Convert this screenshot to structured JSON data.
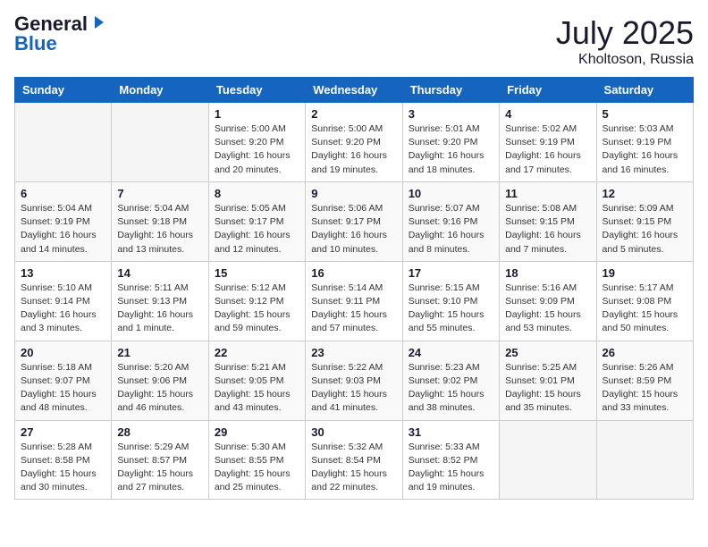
{
  "header": {
    "logo_general": "General",
    "logo_blue": "Blue",
    "month": "July 2025",
    "location": "Kholtoson, Russia"
  },
  "weekdays": [
    "Sunday",
    "Monday",
    "Tuesday",
    "Wednesday",
    "Thursday",
    "Friday",
    "Saturday"
  ],
  "weeks": [
    [
      {
        "day": "",
        "info": ""
      },
      {
        "day": "",
        "info": ""
      },
      {
        "day": "1",
        "info": "Sunrise: 5:00 AM\nSunset: 9:20 PM\nDaylight: 16 hours\nand 20 minutes."
      },
      {
        "day": "2",
        "info": "Sunrise: 5:00 AM\nSunset: 9:20 PM\nDaylight: 16 hours\nand 19 minutes."
      },
      {
        "day": "3",
        "info": "Sunrise: 5:01 AM\nSunset: 9:20 PM\nDaylight: 16 hours\nand 18 minutes."
      },
      {
        "day": "4",
        "info": "Sunrise: 5:02 AM\nSunset: 9:19 PM\nDaylight: 16 hours\nand 17 minutes."
      },
      {
        "day": "5",
        "info": "Sunrise: 5:03 AM\nSunset: 9:19 PM\nDaylight: 16 hours\nand 16 minutes."
      }
    ],
    [
      {
        "day": "6",
        "info": "Sunrise: 5:04 AM\nSunset: 9:19 PM\nDaylight: 16 hours\nand 14 minutes."
      },
      {
        "day": "7",
        "info": "Sunrise: 5:04 AM\nSunset: 9:18 PM\nDaylight: 16 hours\nand 13 minutes."
      },
      {
        "day": "8",
        "info": "Sunrise: 5:05 AM\nSunset: 9:17 PM\nDaylight: 16 hours\nand 12 minutes."
      },
      {
        "day": "9",
        "info": "Sunrise: 5:06 AM\nSunset: 9:17 PM\nDaylight: 16 hours\nand 10 minutes."
      },
      {
        "day": "10",
        "info": "Sunrise: 5:07 AM\nSunset: 9:16 PM\nDaylight: 16 hours\nand 8 minutes."
      },
      {
        "day": "11",
        "info": "Sunrise: 5:08 AM\nSunset: 9:15 PM\nDaylight: 16 hours\nand 7 minutes."
      },
      {
        "day": "12",
        "info": "Sunrise: 5:09 AM\nSunset: 9:15 PM\nDaylight: 16 hours\nand 5 minutes."
      }
    ],
    [
      {
        "day": "13",
        "info": "Sunrise: 5:10 AM\nSunset: 9:14 PM\nDaylight: 16 hours\nand 3 minutes."
      },
      {
        "day": "14",
        "info": "Sunrise: 5:11 AM\nSunset: 9:13 PM\nDaylight: 16 hours\nand 1 minute."
      },
      {
        "day": "15",
        "info": "Sunrise: 5:12 AM\nSunset: 9:12 PM\nDaylight: 15 hours\nand 59 minutes."
      },
      {
        "day": "16",
        "info": "Sunrise: 5:14 AM\nSunset: 9:11 PM\nDaylight: 15 hours\nand 57 minutes."
      },
      {
        "day": "17",
        "info": "Sunrise: 5:15 AM\nSunset: 9:10 PM\nDaylight: 15 hours\nand 55 minutes."
      },
      {
        "day": "18",
        "info": "Sunrise: 5:16 AM\nSunset: 9:09 PM\nDaylight: 15 hours\nand 53 minutes."
      },
      {
        "day": "19",
        "info": "Sunrise: 5:17 AM\nSunset: 9:08 PM\nDaylight: 15 hours\nand 50 minutes."
      }
    ],
    [
      {
        "day": "20",
        "info": "Sunrise: 5:18 AM\nSunset: 9:07 PM\nDaylight: 15 hours\nand 48 minutes."
      },
      {
        "day": "21",
        "info": "Sunrise: 5:20 AM\nSunset: 9:06 PM\nDaylight: 15 hours\nand 46 minutes."
      },
      {
        "day": "22",
        "info": "Sunrise: 5:21 AM\nSunset: 9:05 PM\nDaylight: 15 hours\nand 43 minutes."
      },
      {
        "day": "23",
        "info": "Sunrise: 5:22 AM\nSunset: 9:03 PM\nDaylight: 15 hours\nand 41 minutes."
      },
      {
        "day": "24",
        "info": "Sunrise: 5:23 AM\nSunset: 9:02 PM\nDaylight: 15 hours\nand 38 minutes."
      },
      {
        "day": "25",
        "info": "Sunrise: 5:25 AM\nSunset: 9:01 PM\nDaylight: 15 hours\nand 35 minutes."
      },
      {
        "day": "26",
        "info": "Sunrise: 5:26 AM\nSunset: 8:59 PM\nDaylight: 15 hours\nand 33 minutes."
      }
    ],
    [
      {
        "day": "27",
        "info": "Sunrise: 5:28 AM\nSunset: 8:58 PM\nDaylight: 15 hours\nand 30 minutes."
      },
      {
        "day": "28",
        "info": "Sunrise: 5:29 AM\nSunset: 8:57 PM\nDaylight: 15 hours\nand 27 minutes."
      },
      {
        "day": "29",
        "info": "Sunrise: 5:30 AM\nSunset: 8:55 PM\nDaylight: 15 hours\nand 25 minutes."
      },
      {
        "day": "30",
        "info": "Sunrise: 5:32 AM\nSunset: 8:54 PM\nDaylight: 15 hours\nand 22 minutes."
      },
      {
        "day": "31",
        "info": "Sunrise: 5:33 AM\nSunset: 8:52 PM\nDaylight: 15 hours\nand 19 minutes."
      },
      {
        "day": "",
        "info": ""
      },
      {
        "day": "",
        "info": ""
      }
    ]
  ]
}
